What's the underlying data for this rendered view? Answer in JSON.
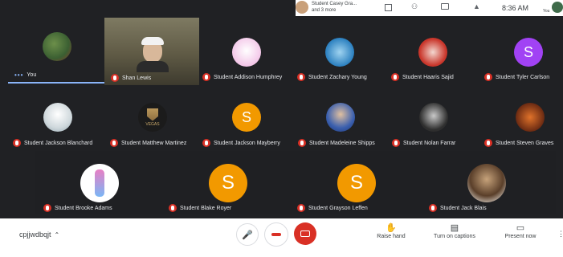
{
  "top_bar": {
    "presenter_line1": "Student Casey Gra...",
    "presenter_line2": "and 3 more",
    "time": "8:36 AM",
    "you_label": "You"
  },
  "participants": [
    {
      "id": "you",
      "name": "You",
      "type": "image",
      "active": true
    },
    {
      "id": "shan",
      "name": "Shan Lewis",
      "type": "video"
    },
    {
      "id": "addison",
      "name": "Student Addison Humphrey",
      "type": "image"
    },
    {
      "id": "zachary",
      "name": "Student Zachary Young",
      "type": "image"
    },
    {
      "id": "haaris",
      "name": "Student Haaris Sajid",
      "type": "image"
    },
    {
      "id": "tyler",
      "name": "Student Tyler Carlson",
      "type": "letter",
      "letter": "S",
      "color": "#a142f4"
    },
    {
      "id": "jackson_b",
      "name": "Student Jackson Blanchard",
      "type": "image"
    },
    {
      "id": "matthew",
      "name": "Student Matthew Martinez",
      "type": "image",
      "logo_text": "VEGAS"
    },
    {
      "id": "jackson_m",
      "name": "Student Jackson Mayberry",
      "type": "letter",
      "letter": "S",
      "color": "#f29900"
    },
    {
      "id": "madeleine",
      "name": "Student Madeleine Shipps",
      "type": "image"
    },
    {
      "id": "nolan",
      "name": "Student Nolan Farrar",
      "type": "image"
    },
    {
      "id": "steven",
      "name": "Student Steven Graves",
      "type": "image"
    },
    {
      "id": "brooke",
      "name": "Student Brooke Adams",
      "type": "image"
    },
    {
      "id": "blake",
      "name": "Student Blake Royer",
      "type": "letter",
      "letter": "S",
      "color": "#f29900"
    },
    {
      "id": "grayson",
      "name": "Student Grayson Leffen",
      "type": "letter",
      "letter": "S",
      "color": "#f29900"
    },
    {
      "id": "jack",
      "name": "Student Jack Blais",
      "type": "image"
    }
  ],
  "bottom_bar": {
    "meeting_code": "cpjjwdbqjt",
    "raise_hand": "Raise hand",
    "captions": "Turn on captions",
    "present": "Present now"
  },
  "colors": {
    "stage_bg": "#202124",
    "mute_red": "#d93025",
    "avatar_orange": "#f29900",
    "avatar_purple": "#a142f4",
    "active_blue": "#8ab4f8"
  }
}
